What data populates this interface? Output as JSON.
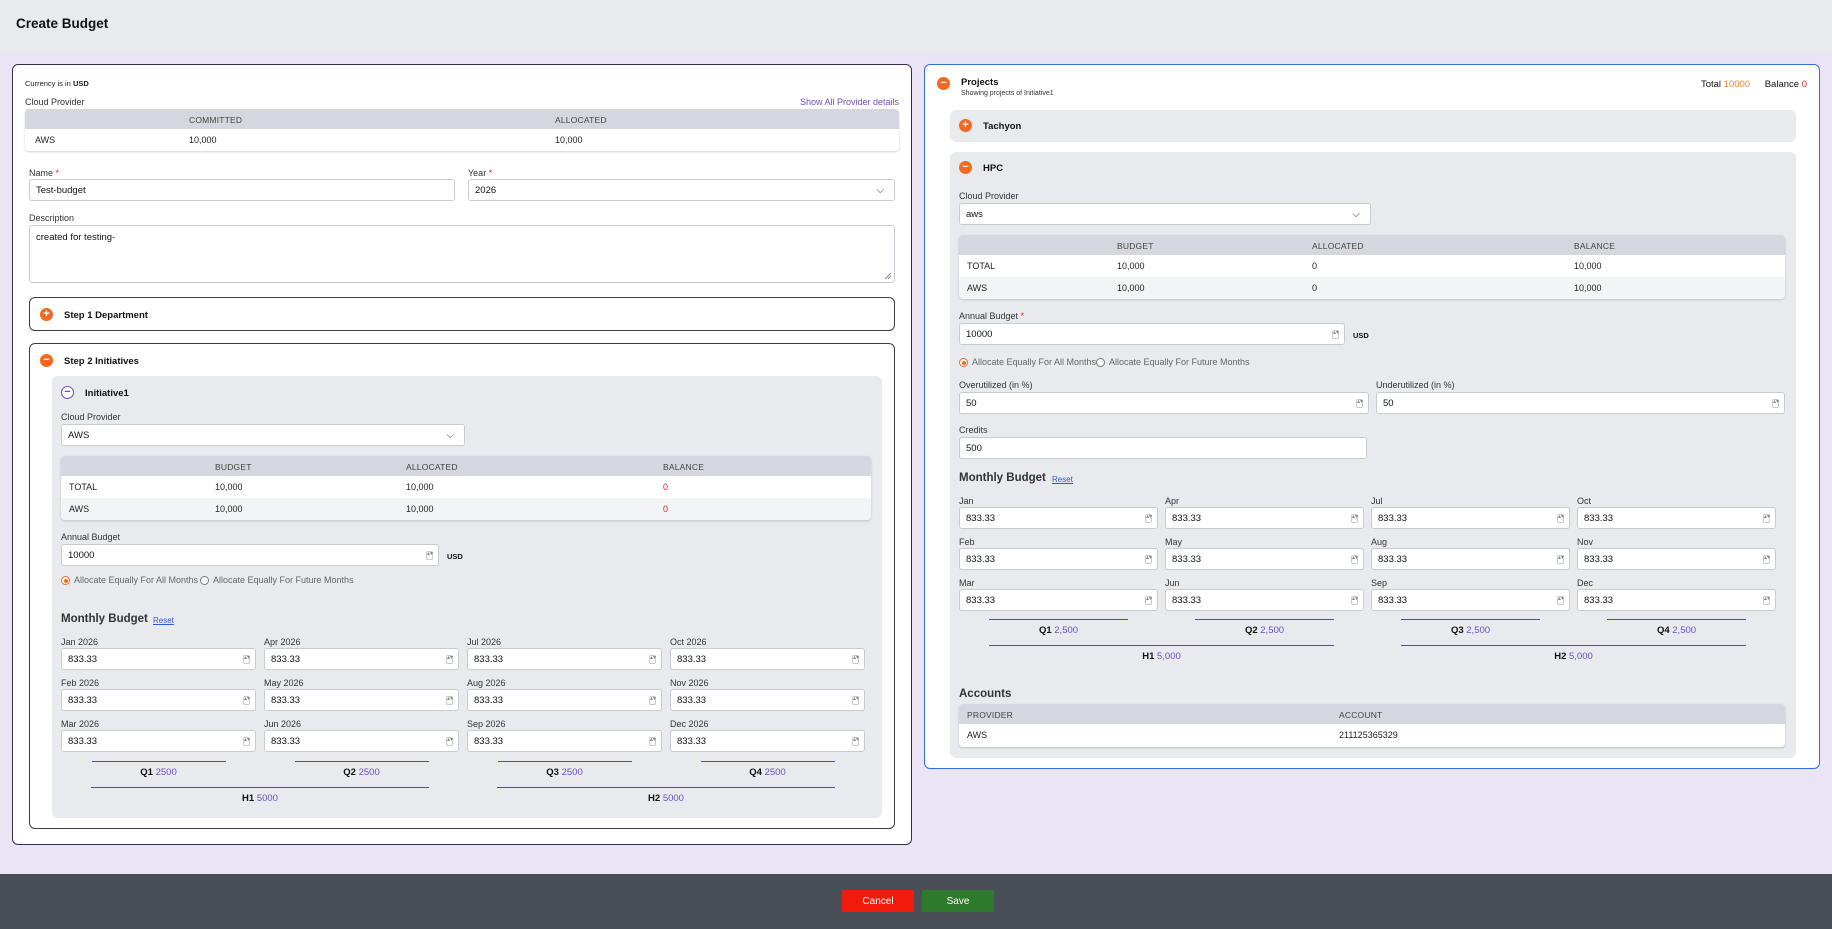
{
  "page": {
    "title": "Create Budget"
  },
  "footer": {
    "cancel_label": "Cancel",
    "save_label": "Save"
  },
  "left": {
    "currency_prefix": "Currency is in",
    "currency": "USD",
    "cloud_provider_label": "Cloud Provider",
    "show_all_link": "Show All Provider details",
    "provider_table": {
      "headers": [
        "COMMITTED",
        "ALLOCATED"
      ],
      "rows": [
        {
          "provider": "AWS",
          "committed": "10,000",
          "allocated": "10,000"
        }
      ]
    },
    "name_label": "Name",
    "name_value": "Test-budget",
    "year_label": "Year",
    "year_value": "2026",
    "required_mark": "*",
    "description_label": "Description",
    "description_value": "created for testing-",
    "step1_title": "Step 1 Department",
    "step2_title": "Step 2 Initiatives",
    "initiative": {
      "title": "Initiative1",
      "cloud_provider_label": "Cloud Provider",
      "cloud_provider_value": "AWS",
      "table": {
        "headers": [
          "BUDGET",
          "ALLOCATED",
          "BALANCE"
        ],
        "rows": [
          {
            "name": "TOTAL",
            "budget": "10,000",
            "allocated": "10,000",
            "balance": "0"
          },
          {
            "name": "AWS",
            "budget": "10,000",
            "allocated": "10,000",
            "balance": "0"
          }
        ]
      },
      "annual_label": "Annual Budget",
      "annual_value": "10000",
      "unit": "USD",
      "alloc_all_label": "Allocate Equally For All Months",
      "alloc_future_label": "Allocate Equally For Future Months",
      "monthly_title": "Monthly Budget",
      "reset_label": "Reset",
      "months": [
        {
          "label": "Jan 2026",
          "value": "833.33"
        },
        {
          "label": "Feb 2026",
          "value": "833.33"
        },
        {
          "label": "Mar 2026",
          "value": "833.33"
        },
        {
          "label": "Apr 2026",
          "value": "833.33"
        },
        {
          "label": "May 2026",
          "value": "833.33"
        },
        {
          "label": "Jun 2026",
          "value": "833.33"
        },
        {
          "label": "Jul 2026",
          "value": "833.33"
        },
        {
          "label": "Aug 2026",
          "value": "833.33"
        },
        {
          "label": "Sep 2026",
          "value": "833.33"
        },
        {
          "label": "Oct 2026",
          "value": "833.33"
        },
        {
          "label": "Nov 2026",
          "value": "833.33"
        },
        {
          "label": "Dec 2026",
          "value": "833.33"
        }
      ],
      "quarters": [
        {
          "label": "Q1",
          "value": "2500"
        },
        {
          "label": "Q2",
          "value": "2500"
        },
        {
          "label": "Q3",
          "value": "2500"
        },
        {
          "label": "Q4",
          "value": "2500"
        }
      ],
      "halves": [
        {
          "label": "H1",
          "value": "5000"
        },
        {
          "label": "H2",
          "value": "5000"
        }
      ]
    }
  },
  "right": {
    "projects_title": "Projects",
    "projects_subtitle": "Showing projects of Initiative1",
    "total_label": "Total",
    "total_value": "10000",
    "balance_label": "Balance",
    "balance_value": "0",
    "tachyon_title": "Tachyon",
    "hpc": {
      "title": "HPC",
      "cloud_provider_label": "Cloud Provider",
      "cloud_provider_value": "aws",
      "table": {
        "headers": [
          "BUDGET",
          "ALLOCATED",
          "BALANCE"
        ],
        "rows": [
          {
            "name": "TOTAL",
            "budget": "10,000",
            "allocated": "0",
            "balance": "10,000"
          },
          {
            "name": "AWS",
            "budget": "10,000",
            "allocated": "0",
            "balance": "10,000"
          }
        ]
      },
      "annual_label": "Annual Budget",
      "annual_value": "10000",
      "unit": "USD",
      "alloc_all_label": "Allocate Equally For All Months",
      "alloc_future_label": "Allocate Equally For Future Months",
      "over_label": "Overutilized (in %)",
      "over_value": "50",
      "under_label": "Underutilized (in %)",
      "under_value": "50",
      "credits_label": "Credits",
      "credits_value": "500",
      "monthly_title": "Monthly Budget",
      "reset_label": "Reset",
      "months": [
        {
          "label": "Jan",
          "value": "833.33"
        },
        {
          "label": "Feb",
          "value": "833.33"
        },
        {
          "label": "Mar",
          "value": "833.33"
        },
        {
          "label": "Apr",
          "value": "833.33"
        },
        {
          "label": "May",
          "value": "833.33"
        },
        {
          "label": "Jun",
          "value": "833.33"
        },
        {
          "label": "Jul",
          "value": "833.33"
        },
        {
          "label": "Aug",
          "value": "833.33"
        },
        {
          "label": "Sep",
          "value": "833.33"
        },
        {
          "label": "Oct",
          "value": "833.33"
        },
        {
          "label": "Nov",
          "value": "833.33"
        },
        {
          "label": "Dec",
          "value": "833.33"
        }
      ],
      "quarters": [
        {
          "label": "Q1",
          "value": "2,500"
        },
        {
          "label": "Q2",
          "value": "2,500"
        },
        {
          "label": "Q3",
          "value": "2,500"
        },
        {
          "label": "Q4",
          "value": "2,500"
        }
      ],
      "halves": [
        {
          "label": "H1",
          "value": "5,000"
        },
        {
          "label": "H2",
          "value": "5,000"
        }
      ],
      "accounts_title": "Accounts",
      "accounts_headers": [
        "PROVIDER",
        "ACCOUNT"
      ],
      "accounts_rows": [
        {
          "provider": "AWS",
          "account": "211125365329"
        }
      ]
    }
  },
  "colors": {
    "accent_orange": "#f26a21",
    "accent_purple": "#6b4fc2",
    "danger": "#e0221b",
    "success": "#2d7a2d"
  }
}
